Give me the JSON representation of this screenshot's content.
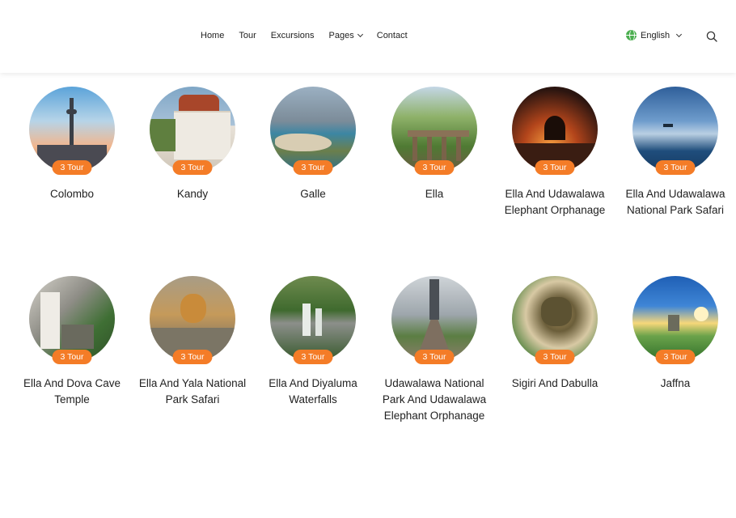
{
  "header": {
    "nav": [
      {
        "label": "Home"
      },
      {
        "label": "Tour"
      },
      {
        "label": "Excursions"
      },
      {
        "label": "Pages",
        "has_dropdown": true
      },
      {
        "label": "Contact"
      }
    ],
    "language": "English",
    "search_icon": "search-icon",
    "globe_icon": "globe-icon"
  },
  "badge_color": "#f47c27",
  "destinations": [
    {
      "name": "Colombo",
      "tours": "3 Tour"
    },
    {
      "name": "Kandy",
      "tours": "3 Tour"
    },
    {
      "name": "Galle",
      "tours": "3 Tour"
    },
    {
      "name": "Ella",
      "tours": "3 Tour"
    },
    {
      "name": "Ella And Udawalawa Elephant Orphanage",
      "tours": "3 Tour"
    },
    {
      "name": "Ella And Udawalawa National Park Safari",
      "tours": "3 Tour"
    },
    {
      "name": "Ella And Dova Cave Temple",
      "tours": "3 Tour"
    },
    {
      "name": "Ella And Yala National Park Safari",
      "tours": "3 Tour"
    },
    {
      "name": "Ella And Diyaluma Waterfalls",
      "tours": "3 Tour"
    },
    {
      "name": "Udawalawa National Park And Udawalawa Elephant Orphanage",
      "tours": "3 Tour"
    },
    {
      "name": "Sigiri And Dabulla",
      "tours": "3 Tour"
    },
    {
      "name": "Jaffna",
      "tours": "3 Tour"
    }
  ]
}
